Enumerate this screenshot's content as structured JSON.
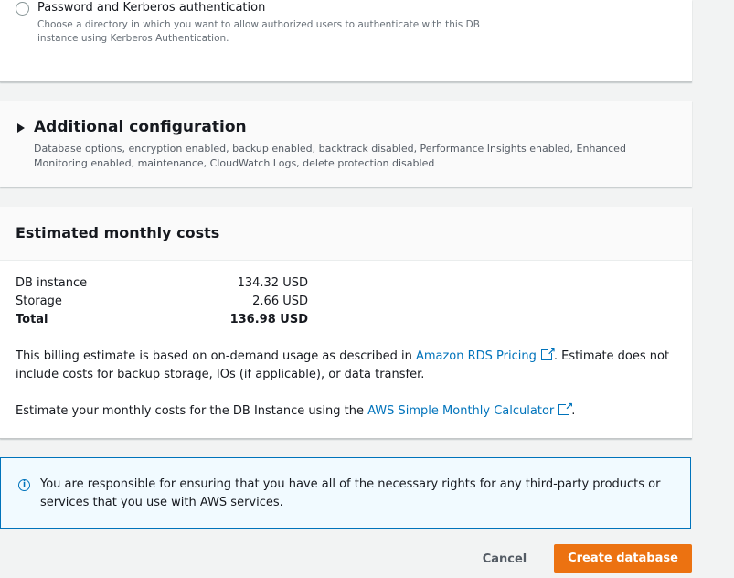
{
  "auth": {
    "option_label": "Password and Kerberos authentication",
    "option_desc": "Choose a directory in which you want to allow authorized users to authenticate with this DB instance using Kerberos Authentication."
  },
  "additional": {
    "title": "Additional configuration",
    "desc": "Database options, encryption enabled, backup enabled, backtrack disabled, Performance Insights enabled, Enhanced Monitoring enabled, maintenance, CloudWatch Logs, delete protection disabled"
  },
  "costs": {
    "title": "Estimated monthly costs",
    "rows": [
      {
        "label": "DB instance",
        "value": "134.32 USD"
      },
      {
        "label": "Storage",
        "value": "2.66 USD"
      },
      {
        "label": "Total",
        "value": "136.98 USD"
      }
    ],
    "billing_pre": "This billing estimate is based on on-demand usage as described in ",
    "billing_link": "Amazon RDS Pricing",
    "billing_post": ". Estimate does not include costs for backup storage, IOs (if applicable), or data transfer.",
    "calc_pre": "Estimate your monthly costs for the DB Instance using the ",
    "calc_link": "AWS Simple Monthly Calculator",
    "calc_post": "."
  },
  "info": {
    "text": "You are responsible for ensuring that you have all of the necessary rights for any third-party products or services that you use with AWS services."
  },
  "footer": {
    "cancel_label": "Cancel",
    "create_label": "Create database"
  },
  "colors": {
    "accent": "#ec7211",
    "link": "#0073bb",
    "info_bg": "#f1faff"
  }
}
